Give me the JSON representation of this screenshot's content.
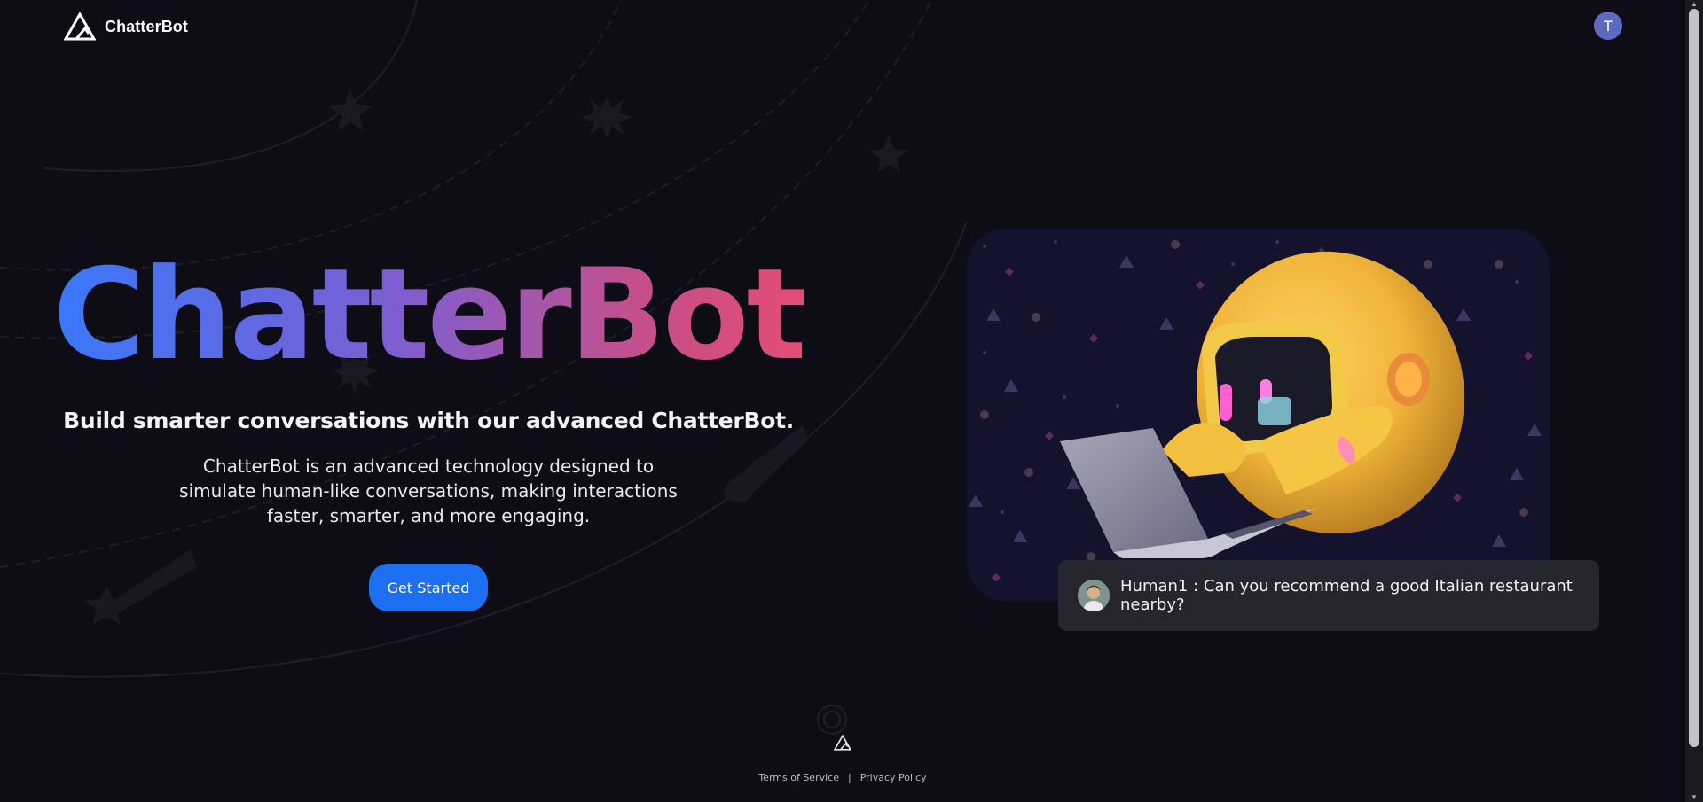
{
  "header": {
    "brand": "ChatterBot",
    "avatar_initial": "T"
  },
  "hero": {
    "title": "ChatterBot",
    "subtitle": "Build smarter conversations with our advanced ChatterBot.",
    "description": "ChatterBot is an advanced technology designed to simulate human-like conversations, making interactions faster, smarter, and more engaging.",
    "cta_label": "Get Started"
  },
  "chat_preview": {
    "message": "Human1 : Can you recommend a good Italian restaurant nearby?"
  },
  "footer": {
    "terms": "Terms of Service",
    "separator": "|",
    "privacy": "Privacy Policy"
  },
  "colors": {
    "background": "#0e0d16",
    "accent": "#1d6ff2",
    "gradient_start": "#2e7cff",
    "gradient_end": "#ee4c6c",
    "avatar": "#5c6bc0",
    "robot": "#f0b43a"
  }
}
